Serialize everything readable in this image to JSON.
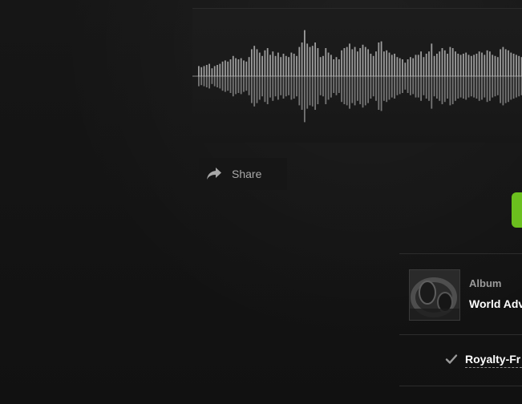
{
  "share": {
    "label": "Share",
    "icon": "share-arrow-icon"
  },
  "album": {
    "heading": "Album",
    "name": "World Adv",
    "thumbnail": "headphones-photo"
  },
  "license": {
    "label": "Royalty-Fr",
    "icon": "check-icon"
  },
  "waveform": {
    "bar_color": "#9d9d9d",
    "amplitudes": [
      0.45,
      0.4,
      0.45,
      0.5,
      0.55,
      0.35,
      0.45,
      0.5,
      0.55,
      0.65,
      0.7,
      0.65,
      0.75,
      0.9,
      0.8,
      0.75,
      0.8,
      0.7,
      0.65,
      0.85,
      1.2,
      1.35,
      1.2,
      1.05,
      0.9,
      1.15,
      1.25,
      0.95,
      1.1,
      0.9,
      1.05,
      0.85,
      1.0,
      0.9,
      0.85,
      1.05,
      1.0,
      0.9,
      1.3,
      1.5,
      2.05,
      1.45,
      1.3,
      1.35,
      1.5,
      1.25,
      0.85,
      0.9,
      1.25,
      1.05,
      0.95,
      0.75,
      0.85,
      0.75,
      1.15,
      1.25,
      1.3,
      1.45,
      1.2,
      1.3,
      1.1,
      1.25,
      1.4,
      1.3,
      1.2,
      1.0,
      0.9,
      1.1,
      1.5,
      1.55,
      1.1,
      1.15,
      1.05,
      0.95,
      1.0,
      0.85,
      0.8,
      0.75,
      0.6,
      0.75,
      0.85,
      0.8,
      0.95,
      0.95,
      1.1,
      0.85,
      1.0,
      1.1,
      1.45,
      0.9,
      1.0,
      1.1,
      1.25,
      1.15,
      1.0,
      1.3,
      1.25,
      1.1,
      1.0,
      0.95,
      1.0,
      1.05,
      0.95,
      0.9,
      0.95,
      1.0,
      1.1,
      1.05,
      0.95,
      1.15,
      1.1,
      0.95,
      0.9,
      0.85,
      1.2,
      1.3,
      1.2,
      1.15,
      1.05,
      1.0,
      0.95,
      0.9,
      0.85,
      0.8
    ]
  }
}
